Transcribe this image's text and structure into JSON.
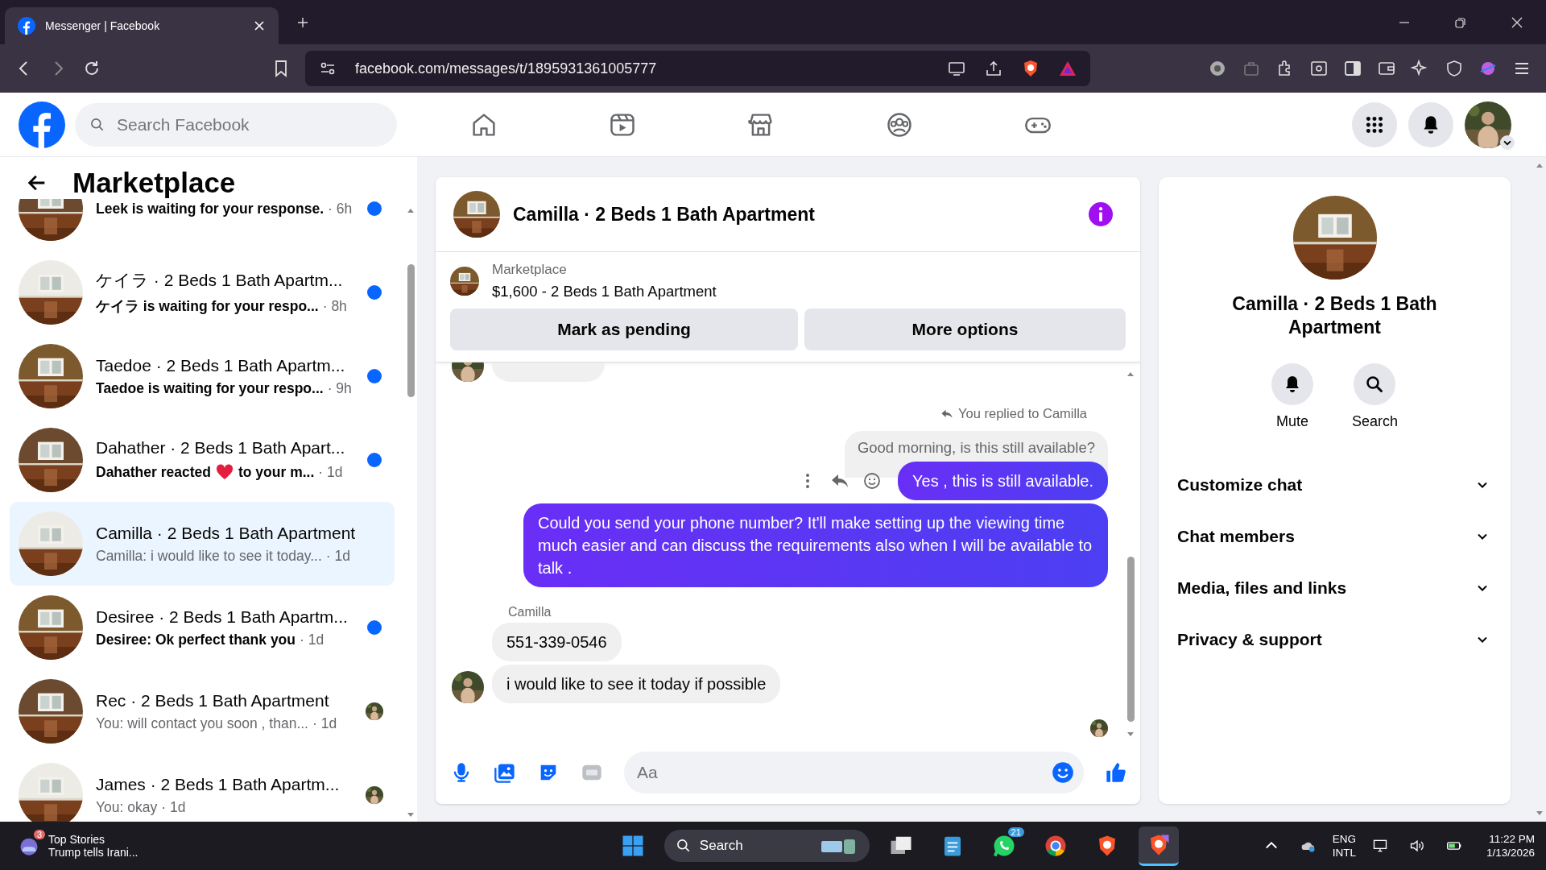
{
  "browser": {
    "tab_title": "Messenger | Facebook",
    "url": "facebook.com/messages/t/1895931361005777"
  },
  "header": {
    "search_placeholder": "Search Facebook"
  },
  "sidebar": {
    "title": "Marketplace",
    "conversations": [
      {
        "preview": "Leek is waiting for your response.",
        "time": "· 6h",
        "unread": true,
        "seen": false,
        "selected": false
      },
      {
        "title": "ケイラ · 2 Beds 1 Bath Apartm...",
        "preview": "ケイラ is waiting for your respo...",
        "time": "· 8h",
        "unread": true,
        "seen": false,
        "selected": false
      },
      {
        "title": "Taedoe · 2 Beds 1 Bath Apartm...",
        "preview": "Taedoe is waiting for your respo...",
        "time": "· 9h",
        "unread": true,
        "seen": false,
        "selected": false
      },
      {
        "title": "Dahather · 2 Beds 1 Bath Apart...",
        "preview": "Dahather reacted",
        "reaction": true,
        "preview_end": "to your m...",
        "time": "· 1d",
        "unread": true,
        "seen": false,
        "selected": false
      },
      {
        "title": "Camilla · 2 Beds 1 Bath Apartment",
        "preview": "Camilla: i would like to see it today...",
        "time": "· 1d",
        "unread": false,
        "seen": false,
        "selected": true
      },
      {
        "title": "Desiree · 2 Beds 1 Bath Apartm...",
        "preview": "Desiree: Ok perfect thank you",
        "time": "· 1d",
        "unread": true,
        "seen": false,
        "selected": false
      },
      {
        "title": "Rec · 2 Beds 1 Bath Apartment",
        "preview": "You: will contact you soon , than...",
        "time": "· 1d",
        "unread": false,
        "seen": true,
        "selected": false
      },
      {
        "title": "James · 2 Beds 1 Bath Apartm...",
        "preview": "You: okay",
        "time": "· 1d",
        "unread": false,
        "seen": true,
        "selected": false
      }
    ]
  },
  "chat": {
    "title": "Camilla · 2 Beds 1 Bath Apartment",
    "listing_label": "Marketplace",
    "listing": "$1,600 - 2 Beds 1 Bath Apartment",
    "buttons": [
      "Mark as pending",
      "More options"
    ],
    "messages": [
      {
        "kind": "clipped",
        "avatar": true
      },
      {
        "kind": "reply_note",
        "text": "You replied to Camilla"
      },
      {
        "kind": "quoted",
        "text": "Good morning, is this still available?"
      },
      {
        "kind": "text",
        "outgoing": true,
        "text": "Yes , this is still available.",
        "hover_actions": true
      },
      {
        "kind": "text",
        "outgoing": true,
        "text": "Could you send your phone number? It'll make setting up the viewing time much easier and can discuss the requirements also when I will be available to talk ."
      },
      {
        "kind": "sender",
        "text": "Camilla"
      },
      {
        "kind": "text",
        "outgoing": false,
        "text": "551-339-0546",
        "avatar": false
      },
      {
        "kind": "text",
        "outgoing": false,
        "text": "i would like to see it today if possible",
        "avatar": true
      }
    ],
    "seen": true,
    "composer_placeholder": "Aa"
  },
  "details": {
    "name": "Camilla · 2 Beds 1 Bath Apartment",
    "actions": [
      {
        "label": "Mute",
        "kind": "bell"
      },
      {
        "label": "Search",
        "kind": "search"
      }
    ],
    "sections": [
      {
        "label": "Customize chat",
        "expanded": false
      },
      {
        "label": "Chat members",
        "expanded": false
      },
      {
        "label": "Media, files and links",
        "expanded": false
      },
      {
        "label": "Privacy & support",
        "expanded": false
      }
    ]
  },
  "taskbar": {
    "news_badge": "3",
    "news_title": "Top Stories",
    "news_text": "Trump tells Irani...",
    "search": "Search",
    "whatsapp_badge": "21",
    "language": "ENG",
    "layout": "INTL",
    "time": "11:22 PM",
    "date": "1/13/2026"
  }
}
